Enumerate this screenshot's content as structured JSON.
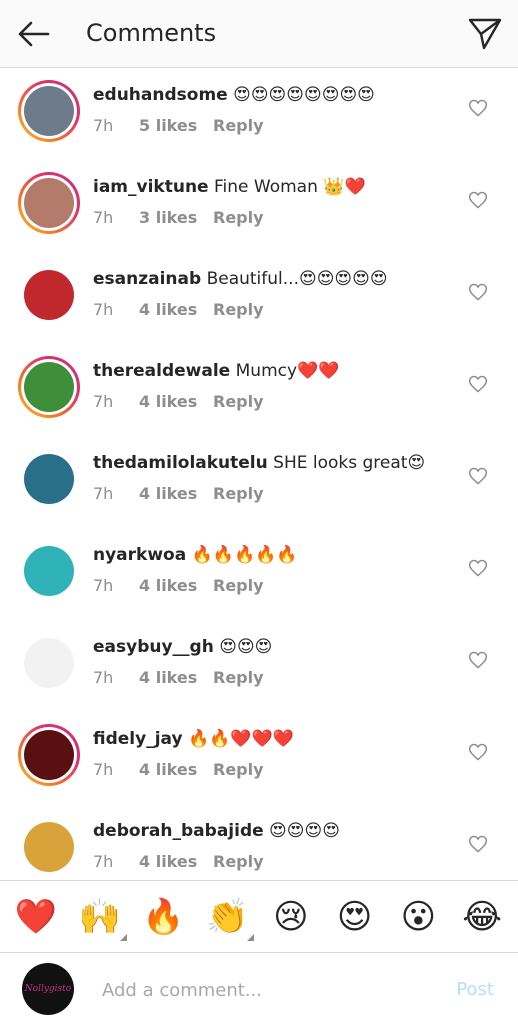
{
  "header": {
    "title": "Comments"
  },
  "colors": {
    "accent": "#3897f0",
    "post_disabled": "#b2dffc",
    "ring_start": "#f9c22b",
    "ring_end": "#c13584"
  },
  "comments": [
    {
      "username": "eduhandsome",
      "text": "😍😍😍😍😍😍😍😍",
      "time": "7h",
      "likes": "5 likes",
      "reply": "Reply",
      "ring": true,
      "avatar_color": "#6d7b8a"
    },
    {
      "username": "iam_viktune",
      "text": "Fine Woman 👑❤️",
      "time": "7h",
      "likes": "3 likes",
      "reply": "Reply",
      "ring": true,
      "avatar_color": "#b57b6a"
    },
    {
      "username": "esanzainab",
      "text": "Beautiful...😍😍😍😍😍",
      "time": "7h",
      "likes": "4 likes",
      "reply": "Reply",
      "ring": false,
      "avatar_color": "#c0282d"
    },
    {
      "username": "therealdewale",
      "text": "Mumcy❤️❤️",
      "time": "7h",
      "likes": "4 likes",
      "reply": "Reply",
      "ring": true,
      "avatar_color": "#3f8f3a"
    },
    {
      "username": "thedamilolakutelu",
      "text": "SHE looks great😍",
      "time": "7h",
      "likes": "4 likes",
      "reply": "Reply",
      "ring": false,
      "avatar_color": "#2a6f8a"
    },
    {
      "username": "nyarkwoa",
      "text": "🔥🔥🔥🔥🔥",
      "time": "7h",
      "likes": "4 likes",
      "reply": "Reply",
      "ring": false,
      "avatar_color": "#2fb3b8"
    },
    {
      "username": "easybuy__gh",
      "text": "😍😍😍",
      "time": "7h",
      "likes": "4 likes",
      "reply": "Reply",
      "ring": false,
      "avatar_color": "#f2f2f2"
    },
    {
      "username": "fidely_jay",
      "text": "🔥🔥❤️❤️❤️",
      "time": "7h",
      "likes": "4 likes",
      "reply": "Reply",
      "ring": true,
      "avatar_color": "#5a1010"
    },
    {
      "username": "deborah_babajide",
      "text": "😍😍😍😍",
      "time": "7h",
      "likes": "4 likes",
      "reply": "Reply",
      "ring": false,
      "avatar_color": "#d9a23b"
    }
  ],
  "emoji_bar": [
    {
      "emoji": "❤️",
      "name": "heart",
      "has_variants": false
    },
    {
      "emoji": "🙌",
      "name": "raised-hands",
      "has_variants": true
    },
    {
      "emoji": "🔥",
      "name": "fire",
      "has_variants": false
    },
    {
      "emoji": "👏",
      "name": "clap",
      "has_variants": true
    },
    {
      "emoji": "😢",
      "name": "crying",
      "has_variants": false
    },
    {
      "emoji": "😍",
      "name": "heart-eyes",
      "has_variants": false
    },
    {
      "emoji": "😮",
      "name": "surprised",
      "has_variants": false
    },
    {
      "emoji": "😂",
      "name": "tears-of-joy",
      "has_variants": false
    }
  ],
  "composer": {
    "placeholder": "Add a comment...",
    "post_label": "Post",
    "avatar_text": "Nollygisto"
  }
}
